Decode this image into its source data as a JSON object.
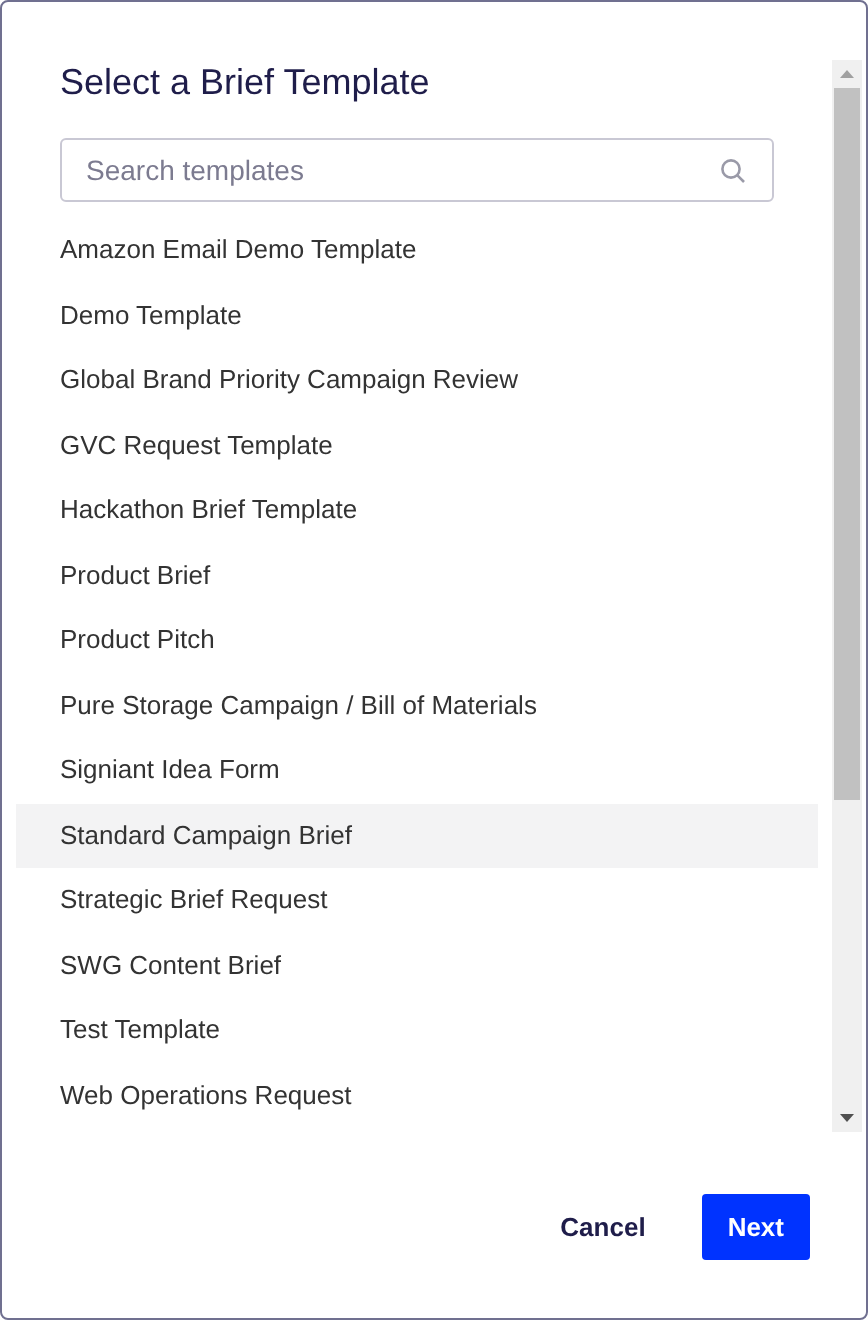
{
  "dialog": {
    "title": "Select a Brief Template"
  },
  "search": {
    "placeholder": "Search templates"
  },
  "templates": [
    {
      "label": "Amazon Email Demo Template",
      "selected": false
    },
    {
      "label": "Demo Template",
      "selected": false
    },
    {
      "label": "Global Brand Priority Campaign Review",
      "selected": false
    },
    {
      "label": "GVC Request Template",
      "selected": false
    },
    {
      "label": "Hackathon Brief Template",
      "selected": false
    },
    {
      "label": "Product Brief",
      "selected": false
    },
    {
      "label": "Product Pitch",
      "selected": false
    },
    {
      "label": "Pure Storage Campaign / Bill of Materials",
      "selected": false
    },
    {
      "label": "Signiant Idea Form",
      "selected": false
    },
    {
      "label": "Standard Campaign Brief",
      "selected": true
    },
    {
      "label": "Strategic Brief Request",
      "selected": false
    },
    {
      "label": "SWG Content Brief",
      "selected": false
    },
    {
      "label": "Test Template",
      "selected": false
    },
    {
      "label": "Web Operations Request",
      "selected": false
    }
  ],
  "buttons": [
    {
      "label": "Cancel",
      "kind": "secondary"
    },
    {
      "label": "Next",
      "kind": "primary"
    }
  ]
}
